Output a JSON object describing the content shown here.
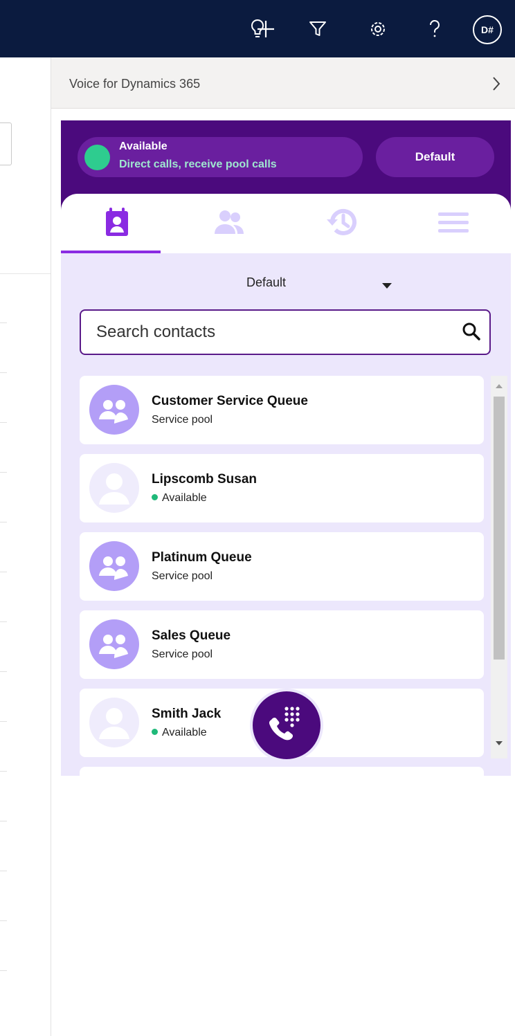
{
  "topbar": {
    "icons": [
      "lightbulb-icon",
      "plus-icon",
      "filter-icon",
      "settings-icon",
      "help-icon"
    ],
    "user_initials": "D#"
  },
  "panel": {
    "title": "Voice for Dynamics 365",
    "collapse_icon": "chevron-right-icon"
  },
  "status": {
    "title": "Available",
    "subtitle": "Direct calls, receive pool calls",
    "color": "#2ecc8f",
    "profile_button": "Default"
  },
  "tabs": [
    {
      "name": "contacts",
      "icon": "contact-book-icon",
      "active": true
    },
    {
      "name": "teams",
      "icon": "users-icon",
      "active": false
    },
    {
      "name": "history",
      "icon": "history-icon",
      "active": false
    },
    {
      "name": "menu",
      "icon": "hamburger-icon",
      "active": false
    }
  ],
  "group_select": {
    "value": "Default"
  },
  "search": {
    "placeholder": "Search contacts"
  },
  "contacts": [
    {
      "name": "Customer Service Queue",
      "subtitle": "Service pool",
      "type": "pool"
    },
    {
      "name": "Lipscomb Susan",
      "subtitle": "Available",
      "type": "person"
    },
    {
      "name": "Platinum Queue",
      "subtitle": "Service pool",
      "type": "pool"
    },
    {
      "name": "Sales Queue",
      "subtitle": "Service pool",
      "type": "pool"
    },
    {
      "name": "Smith Jack",
      "subtitle": "Available",
      "type": "person"
    }
  ],
  "colors": {
    "topbar": "#0b1b3f",
    "brand_purple": "#4b0a7d",
    "accent_purple": "#8a2be2",
    "pool_avatar": "#b39ef7",
    "available_green": "#1fb979"
  }
}
